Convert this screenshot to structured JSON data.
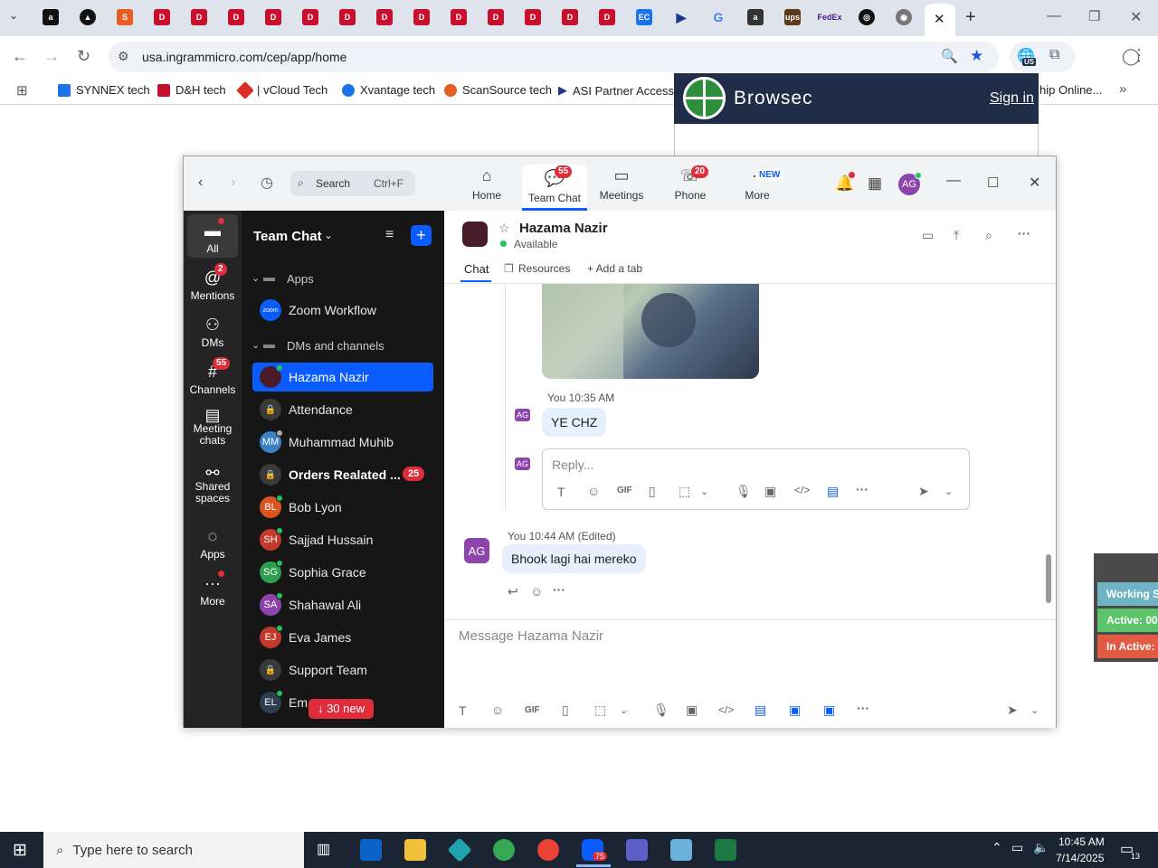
{
  "browser": {
    "address": "usa.ingrammicro.com/cep/app/home",
    "ext_badge": "US",
    "bookmarks": [
      "SYNNEX tech",
      "D&H tech",
      "| vCloud Tech",
      "Xvantage tech",
      "ScanSource tech",
      "ASI Partner Access t...",
      "hip Online..."
    ],
    "bookmark_colors": [
      "#1a73e8",
      "#c8102e",
      "#d93025",
      "#1a73e8",
      "#e85d21",
      "#1a3a8a",
      "#555"
    ]
  },
  "browsec": {
    "name": "Browsec",
    "signin": "Sign in"
  },
  "zoom": {
    "search_label": "Search",
    "search_shortcut": "Ctrl+F",
    "tabs": [
      {
        "label": "Home",
        "badge": ""
      },
      {
        "label": "Team Chat",
        "badge": "55"
      },
      {
        "label": "Meetings",
        "badge": ""
      },
      {
        "label": "Phone",
        "badge": "20"
      },
      {
        "label": "More",
        "badge": "NEW"
      }
    ],
    "avatar": "AG",
    "rail": [
      {
        "label": "All",
        "badge": ""
      },
      {
        "label": "Mentions",
        "badge": "2"
      },
      {
        "label": "DMs",
        "badge": ""
      },
      {
        "label": "Channels",
        "badge": "55"
      },
      {
        "label": "Meeting chats",
        "badge": ""
      },
      {
        "label": "Shared spaces",
        "badge": ""
      },
      {
        "label": "Apps",
        "badge": ""
      },
      {
        "label": "More",
        "badge": ""
      }
    ],
    "list_title": "Team Chat",
    "sections": {
      "apps": "Apps",
      "dms": "DMs and channels"
    },
    "items": [
      {
        "name": "Zoom Workflow",
        "initials": "zoom",
        "color": "#0b5cff",
        "badge": ""
      },
      {
        "name": "Hazama Nazir",
        "initials": "",
        "color": "#4a1c2a",
        "badge": ""
      },
      {
        "name": "Attendance",
        "initials": "🔒",
        "color": "#3a3a3a",
        "badge": ""
      },
      {
        "name": "Muhammad Muhib",
        "initials": "MM",
        "color": "#3b82c4",
        "badge": ""
      },
      {
        "name": "Orders Realated ...",
        "initials": "🔒",
        "color": "#3a3a3a",
        "badge": "25"
      },
      {
        "name": "Bob Lyon",
        "initials": "BL",
        "color": "#d9541f",
        "badge": ""
      },
      {
        "name": "Sajjad Hussain",
        "initials": "SH",
        "color": "#c0392b",
        "badge": ""
      },
      {
        "name": "Sophia Grace",
        "initials": "SG",
        "color": "#2e9e4f",
        "badge": ""
      },
      {
        "name": "Shahawal Ali",
        "initials": "SA",
        "color": "#8e44ad",
        "badge": ""
      },
      {
        "name": "Eva James",
        "initials": "EJ",
        "color": "#c0392b",
        "badge": ""
      },
      {
        "name": "Support Team",
        "initials": "🔒",
        "color": "#3a3a3a",
        "badge": ""
      },
      {
        "name": "Em...",
        "initials": "EL",
        "color": "#2c3e50",
        "badge": ""
      }
    ],
    "new_pill": "↓ 30 new",
    "chat": {
      "name": "Hazama Nazir",
      "status": "Available",
      "subtabs": [
        "Chat",
        "Resources",
        "+ Add a tab"
      ],
      "msg1_meta": "You 10:35 AM",
      "msg1_text": "YE CHZ",
      "reply_placeholder": "Reply...",
      "msg2_meta": "You 10:44 AM (Edited)",
      "msg2_text": "Bhook lagi hai mereko",
      "compose_placeholder": "Message Hazama Nazir",
      "initials": "AG"
    }
  },
  "float_panel": [
    "Working S",
    "Active: 00",
    "In Active:"
  ],
  "taskbar": {
    "search": "Type here to search",
    "time": "10:45 AM",
    "date": "7/14/2025",
    "notif": "13",
    "zoom_badge": "75"
  }
}
